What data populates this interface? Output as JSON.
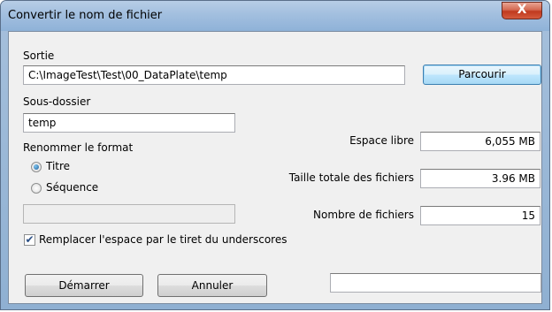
{
  "window": {
    "title": "Convertir le nom de fichier",
    "close_glyph": "X"
  },
  "output": {
    "label": "Sortie",
    "path_value": "C:\\ImageTest\\Test\\00_DataPlate\\temp",
    "browse_label": "Parcourir"
  },
  "subfolder": {
    "label": "Sous-dossier",
    "value": "temp"
  },
  "rename_format": {
    "label": "Renommer le format",
    "options": [
      {
        "label": "Titre",
        "checked": true
      },
      {
        "label": "Séquence",
        "checked": false
      }
    ],
    "extra_field_value": ""
  },
  "stats": {
    "free_space_label": "Espace libre",
    "free_space_value": "6,055 MB",
    "total_size_label": "Taille totale des fichiers",
    "total_size_value": "3.96 MB",
    "file_count_label": "Nombre de fichiers",
    "file_count_value": "15"
  },
  "replace_option": {
    "label": "Remplacer l'espace par le tiret du underscores",
    "checked": true,
    "check_glyph": "✔"
  },
  "actions": {
    "start_label": "Démarrer",
    "cancel_label": "Annuler",
    "status_value": ""
  }
}
